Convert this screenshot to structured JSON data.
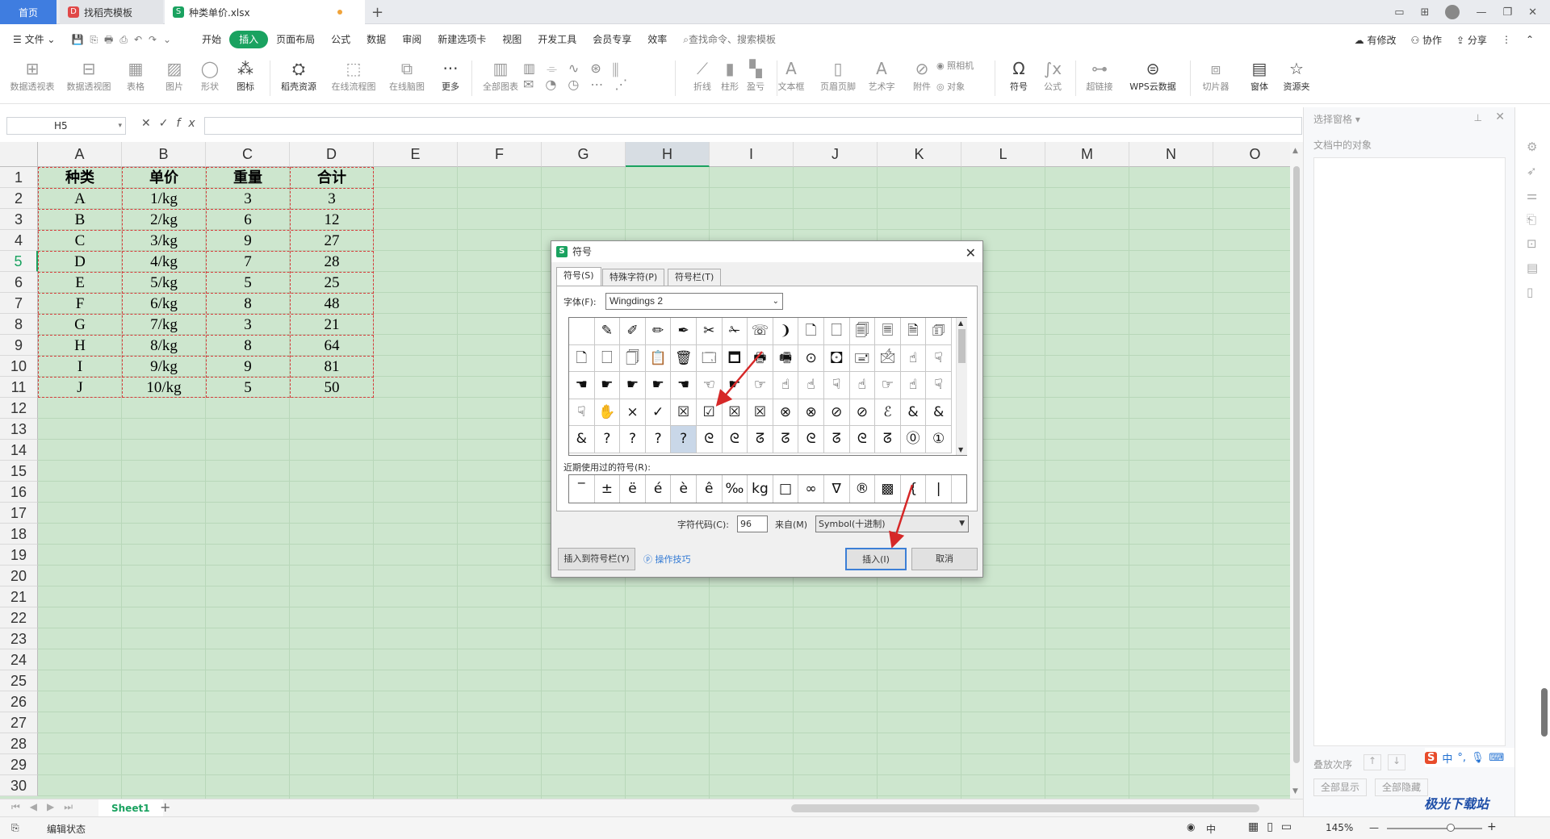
{
  "titlebar": {
    "home_tab": "首页",
    "template_tab": "找稻壳模板",
    "file_tab": "种类单价.xlsx",
    "add_tab": "+"
  },
  "menubar": {
    "file": "文件",
    "items": [
      "开始",
      "插入",
      "页面布局",
      "公式",
      "数据",
      "审阅",
      "新建选项卡",
      "视图",
      "开发工具",
      "会员专享",
      "效率"
    ],
    "active": "插入",
    "search": "查找命令、搜索模板",
    "right": [
      "有修改",
      "协作",
      "分享"
    ]
  },
  "ribbon": {
    "buttons": [
      "数据透视表",
      "数据透视图",
      "表格",
      "图片",
      "形状",
      "图标",
      "稻壳资源",
      "在线流程图",
      "在线脑图",
      "更多",
      "全部图表",
      "折线",
      "柱形",
      "盈亏",
      "文本框",
      "页眉页脚",
      "艺术字",
      "附件",
      "照相机",
      "对象",
      "符号",
      "公式",
      "超链接",
      "WPS云数据",
      "切片器",
      "窗体",
      "资源夹"
    ]
  },
  "formula_bar": {
    "cell_ref": "H5",
    "fx": "fx"
  },
  "sheet": {
    "columns": [
      "A",
      "B",
      "C",
      "D",
      "E",
      "F",
      "G",
      "H",
      "I",
      "J",
      "K",
      "L",
      "M",
      "N",
      "O"
    ],
    "selected_column": "H",
    "rows": [
      "1",
      "2",
      "3",
      "4",
      "5",
      "6",
      "7",
      "8",
      "9",
      "10",
      "11",
      "12",
      "13",
      "14",
      "15",
      "16",
      "17",
      "18",
      "19",
      "20",
      "21",
      "22",
      "23",
      "24",
      "25",
      "26",
      "27",
      "28",
      "29",
      "30"
    ],
    "selected_row": "5",
    "headers": [
      "种类",
      "单价",
      "重量",
      "合计"
    ],
    "data": [
      [
        "A",
        "1/kg",
        "3",
        "3"
      ],
      [
        "B",
        "2/kg",
        "6",
        "12"
      ],
      [
        "C",
        "3/kg",
        "9",
        "27"
      ],
      [
        "D",
        "4/kg",
        "7",
        "28"
      ],
      [
        "E",
        "5/kg",
        "5",
        "25"
      ],
      [
        "F",
        "6/kg",
        "8",
        "48"
      ],
      [
        "G",
        "7/kg",
        "3",
        "21"
      ],
      [
        "H",
        "8/kg",
        "8",
        "64"
      ],
      [
        "I",
        "9/kg",
        "9",
        "81"
      ],
      [
        "J",
        "10/kg",
        "5",
        "50"
      ]
    ],
    "sheet_tab": "Sheet1"
  },
  "statusbar": {
    "mode": "编辑状态",
    "zoom": "145%",
    "input_lang": "中"
  },
  "right_pane": {
    "title": "选择窗格",
    "subtitle": "文档中的对象",
    "order_label": "叠放次序",
    "show_all": "全部显示",
    "hide_all": "全部隐藏"
  },
  "dialog": {
    "title": "符号",
    "tabs": [
      "符号(S)",
      "特殊字符(P)",
      "符号栏(T)"
    ],
    "font_label": "字体(F):",
    "font_value": "Wingdings 2",
    "symbols": [
      [
        "",
        "✎",
        "✐",
        "✏",
        "✒",
        "✂",
        "✁",
        "☏",
        "❩",
        "🗋",
        "🗌",
        "🗐",
        "🗏",
        "🗎",
        "🗊"
      ],
      [
        "🗋",
        "🗌",
        "🗍",
        "📋",
        "🗑",
        "🗔",
        "🗖",
        "🖶",
        "🖷",
        "⊙",
        "🖸",
        "🖃",
        "🖄",
        "☝",
        "☟"
      ],
      [
        "☚",
        "☛",
        "☛",
        "☛",
        "☚",
        "☜",
        "☛",
        "☞",
        "☝",
        "☝",
        "☟",
        "☝",
        "☞",
        "☝",
        "☟"
      ],
      [
        "☟",
        "✋",
        "×",
        "✓",
        "☒",
        "☑",
        "☒",
        "☒",
        "⊗",
        "⊗",
        "⊘",
        "⊘",
        "ℰ",
        "&",
        "&"
      ],
      [
        "&",
        "?",
        "?",
        "?",
        "?",
        "ᘓ",
        "ᘓ",
        "ᘔ",
        "ᘔ",
        "ᘓ",
        "ᘔ",
        "ᘓ",
        "ᘔ",
        "⓪",
        "①"
      ]
    ],
    "recent_label": "近期使用过的符号(R):",
    "recent": [
      "‾",
      "±",
      "ë",
      "é",
      "è",
      "ê",
      "‰",
      "kg",
      "□",
      "∞",
      "ᐁ",
      "®",
      "▩",
      "{",
      "|"
    ],
    "code_label": "字符代码(C):",
    "code_value": "96",
    "from_label": "来自(M)",
    "from_value": "Symbol(十进制)",
    "insert_to_bar": "插入到符号栏(Y)",
    "tips": "操作技巧",
    "insert": "插入(I)",
    "cancel": "取消"
  },
  "watermark": "极光下载站",
  "accent_color": "#1aa260",
  "annotation_color": "#d62828"
}
